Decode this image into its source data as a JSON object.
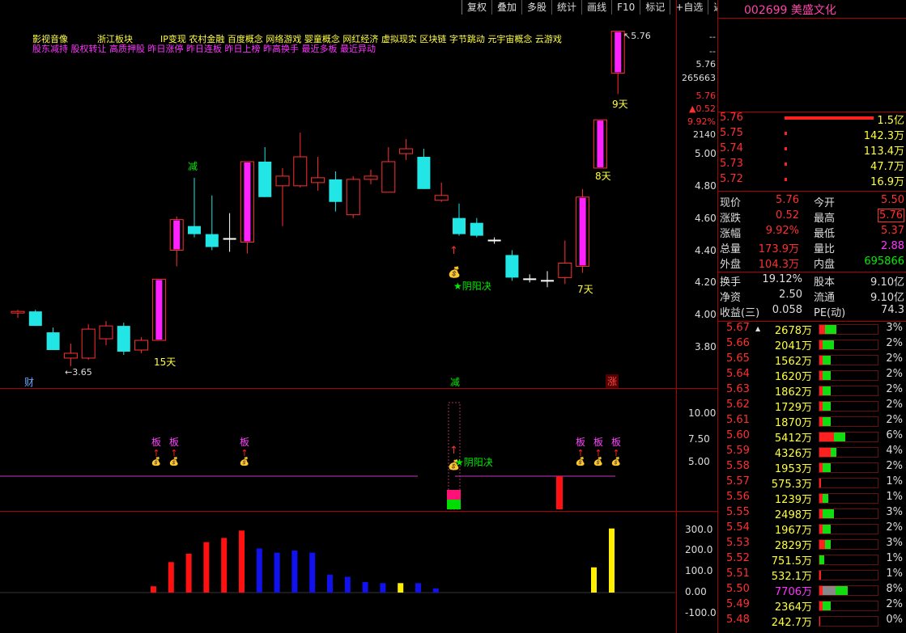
{
  "toolbar": [
    "复权",
    "叠加",
    "多股",
    "统计",
    "画线",
    "F10",
    "标记",
    "+自选",
    "返回"
  ],
  "stock": {
    "code": "002699",
    "name": "美盛文化"
  },
  "concepts": {
    "row1a": "影视音像",
    "row1b": "浙江板块",
    "row1c": "IP变现 农村金融 百度概念 网络游戏 婴童概念 网红经济 虚拟现实 区块链 字节跳动 元宇宙概念 云游戏",
    "row2": "股东减持 股权转让 高质押股 昨日涨停 昨日连板 昨日上榜 昨高换手 最近多板 最近异动"
  },
  "chart_labels": {
    "high_marker": "5.76",
    "low_marker": "3.65",
    "days": [
      "15天",
      "7天",
      "8天",
      "9天"
    ],
    "jian": "减",
    "yinyang": "★阴阳决",
    "bottom_cai": "财",
    "bottom_jian": "减",
    "bottom_zhang": "涨",
    "ban": "板"
  },
  "price_axis": {
    "top_values": [
      "--",
      "--",
      "5.76",
      "265663",
      "5.76",
      "▲0.52",
      "9.92%",
      "2140"
    ],
    "ticks": [
      "5.00",
      "4.80",
      "4.60",
      "4.40",
      "4.20",
      "4.00",
      "3.80"
    ]
  },
  "mid_axis": [
    "10.00",
    "7.50",
    "5.00"
  ],
  "bottom_axis": [
    "300.0",
    "200.0",
    "100.0",
    "0.00",
    "-100.0"
  ],
  "chart_data": {
    "type": "candlestick",
    "ylim": [
      3.6,
      5.85
    ],
    "candles": [
      {
        "o": 4.01,
        "h": 4.03,
        "l": 3.98,
        "c": 4.02,
        "t": "r"
      },
      {
        "o": 4.02,
        "h": 4.03,
        "l": 3.96,
        "c": 3.93,
        "t": "c"
      },
      {
        "o": 3.89,
        "h": 3.92,
        "l": 3.78,
        "c": 3.78,
        "t": "c"
      },
      {
        "o": 3.76,
        "h": 3.82,
        "l": 3.68,
        "c": 3.73,
        "t": "r"
      },
      {
        "o": 3.73,
        "h": 3.94,
        "l": 3.72,
        "c": 3.91,
        "t": "r"
      },
      {
        "o": 3.85,
        "h": 3.96,
        "l": 3.81,
        "c": 3.93,
        "t": "r"
      },
      {
        "o": 3.93,
        "h": 3.95,
        "l": 3.75,
        "c": 3.77,
        "t": "c"
      },
      {
        "o": 3.78,
        "h": 3.86,
        "l": 3.76,
        "c": 3.84,
        "t": "r"
      },
      {
        "o": 3.84,
        "h": 4.21,
        "l": 3.84,
        "c": 4.22,
        "t": "m"
      },
      {
        "o": 4.4,
        "h": 4.61,
        "l": 4.3,
        "c": 4.59,
        "t": "m"
      },
      {
        "o": 4.55,
        "h": 4.85,
        "l": 4.48,
        "c": 4.5,
        "t": "c"
      },
      {
        "o": 4.5,
        "h": 4.74,
        "l": 4.4,
        "c": 4.42,
        "t": "c"
      },
      {
        "o": 4.47,
        "h": 4.63,
        "l": 4.39,
        "c": 4.47,
        "t": "w"
      },
      {
        "o": 4.45,
        "h": 4.95,
        "l": 4.38,
        "c": 4.95,
        "t": "m"
      },
      {
        "o": 4.95,
        "h": 5.04,
        "l": 4.74,
        "c": 4.73,
        "t": "c"
      },
      {
        "o": 4.86,
        "h": 4.91,
        "l": 4.55,
        "c": 4.8,
        "t": "r"
      },
      {
        "o": 4.8,
        "h": 5.13,
        "l": 4.79,
        "c": 4.98,
        "t": "r"
      },
      {
        "o": 4.85,
        "h": 4.98,
        "l": 4.77,
        "c": 4.82,
        "t": "r"
      },
      {
        "o": 4.84,
        "h": 4.89,
        "l": 4.64,
        "c": 4.7,
        "t": "c"
      },
      {
        "o": 4.62,
        "h": 4.86,
        "l": 4.6,
        "c": 4.84,
        "t": "r"
      },
      {
        "o": 4.84,
        "h": 4.9,
        "l": 4.81,
        "c": 4.86,
        "t": "r"
      },
      {
        "o": 4.76,
        "h": 5.04,
        "l": 4.76,
        "c": 4.95,
        "t": "r"
      },
      {
        "o": 5.0,
        "h": 5.09,
        "l": 4.96,
        "c": 5.03,
        "t": "r"
      },
      {
        "o": 4.98,
        "h": 5.03,
        "l": 4.79,
        "c": 4.78,
        "t": "c"
      },
      {
        "o": 4.74,
        "h": 4.82,
        "l": 4.7,
        "c": 4.71,
        "t": "r"
      },
      {
        "o": 4.6,
        "h": 4.69,
        "l": 4.49,
        "c": 4.5,
        "t": "c"
      },
      {
        "o": 4.57,
        "h": 4.6,
        "l": 4.48,
        "c": 4.49,
        "t": "c"
      },
      {
        "o": 4.46,
        "h": 4.48,
        "l": 4.44,
        "c": 4.46,
        "t": "w"
      },
      {
        "o": 4.37,
        "h": 4.4,
        "l": 4.21,
        "c": 4.23,
        "t": "c"
      },
      {
        "o": 4.22,
        "h": 4.25,
        "l": 4.2,
        "c": 4.22,
        "t": "w"
      },
      {
        "o": 4.21,
        "h": 4.27,
        "l": 4.17,
        "c": 4.21,
        "t": "w"
      },
      {
        "o": 4.23,
        "h": 4.46,
        "l": 4.19,
        "c": 4.32,
        "t": "r"
      },
      {
        "o": 4.3,
        "h": 4.78,
        "l": 4.26,
        "c": 4.73,
        "t": "m"
      },
      {
        "o": 5.21,
        "h": 5.18,
        "l": 4.91,
        "c": 4.91,
        "t": "m"
      },
      {
        "o": 5.76,
        "h": 5.76,
        "l": 5.37,
        "c": 5.5,
        "t": "m"
      }
    ],
    "bottom_bars": [
      {
        "v": 30,
        "c": "r"
      },
      {
        "v": 145,
        "c": "r"
      },
      {
        "v": 185,
        "c": "r"
      },
      {
        "v": 240,
        "c": "r"
      },
      {
        "v": 260,
        "c": "r"
      },
      {
        "v": 295,
        "c": "r"
      },
      {
        "v": 210,
        "c": "b"
      },
      {
        "v": 190,
        "c": "b"
      },
      {
        "v": 200,
        "c": "b"
      },
      {
        "v": 190,
        "c": "b"
      },
      {
        "v": 85,
        "c": "b"
      },
      {
        "v": 75,
        "c": "b"
      },
      {
        "v": 50,
        "c": "b"
      },
      {
        "v": 45,
        "c": "b"
      },
      {
        "v": 45,
        "c": "y"
      },
      {
        "v": 45,
        "c": "b"
      },
      {
        "v": 20,
        "c": "b"
      },
      {
        "v": 0,
        "c": "n"
      },
      {
        "v": 0,
        "c": "n"
      },
      {
        "v": 0,
        "c": "n"
      },
      {
        "v": 0,
        "c": "n"
      },
      {
        "v": 0,
        "c": "n"
      },
      {
        "v": 0,
        "c": "n"
      },
      {
        "v": 0,
        "c": "n"
      },
      {
        "v": 0,
        "c": "n"
      },
      {
        "v": 0,
        "c": "n"
      },
      {
        "v": 0,
        "c": "n"
      },
      {
        "v": 0,
        "c": "n"
      },
      {
        "v": 0,
        "c": "n"
      },
      {
        "v": 0,
        "c": "n"
      },
      {
        "v": 0,
        "c": "n"
      },
      {
        "v": 0,
        "c": "n"
      },
      {
        "v": 120,
        "c": "y"
      },
      {
        "v": 305,
        "c": "y"
      }
    ]
  },
  "orderbook": [
    {
      "p": "5.76",
      "v": "1.5亿",
      "bar": 1.0
    },
    {
      "p": "5.75",
      "v": "142.3万",
      "bar": 0.02
    },
    {
      "p": "5.74",
      "v": "113.4万",
      "bar": 0.02
    },
    {
      "p": "5.73",
      "v": "47.7万",
      "bar": 0.01
    },
    {
      "p": "5.72",
      "v": "16.9万",
      "bar": 0.01
    }
  ],
  "quote": [
    {
      "l1": "现价",
      "v1": "5.76",
      "c1": "red",
      "l2": "今开",
      "v2": "5.50",
      "c2": "red"
    },
    {
      "l1": "涨跌",
      "v1": "0.52",
      "c1": "red",
      "l2": "最高",
      "v2": "5.76",
      "c2": "red"
    },
    {
      "l1": "涨幅",
      "v1": "9.92%",
      "c1": "red",
      "l2": "最低",
      "v2": "5.37",
      "c2": "red"
    },
    {
      "l1": "总量",
      "v1": "173.9万",
      "c1": "red",
      "l2": "量比",
      "v2": "2.88",
      "c2": "mag"
    },
    {
      "l1": "外盘",
      "v1": "104.3万",
      "c1": "red",
      "l2": "内盘",
      "v2": "695866",
      "c2": "grn"
    }
  ],
  "fundamentals": [
    {
      "l1": "换手",
      "v1": "19.12%",
      "l2": "股本",
      "v2": "9.10亿"
    },
    {
      "l1": "净资",
      "v1": "2.50",
      "l2": "流通",
      "v2": "9.10亿"
    },
    {
      "l1": "收益(三)",
      "v1": "0.058",
      "l2": "PE(动)",
      "v2": "74.3"
    }
  ],
  "distribution": [
    {
      "p": "5.67",
      "v": "2678万",
      "pct": "3%",
      "r": 0.1,
      "g": 0.2
    },
    {
      "p": "5.66",
      "v": "2041万",
      "pct": "2%",
      "r": 0.05,
      "g": 0.2
    },
    {
      "p": "5.65",
      "v": "1562万",
      "pct": "2%",
      "r": 0.05,
      "g": 0.15
    },
    {
      "p": "5.64",
      "v": "1620万",
      "pct": "2%",
      "r": 0.05,
      "g": 0.15
    },
    {
      "p": "5.63",
      "v": "1862万",
      "pct": "2%",
      "r": 0.05,
      "g": 0.15
    },
    {
      "p": "5.62",
      "v": "1729万",
      "pct": "2%",
      "r": 0.05,
      "g": 0.15
    },
    {
      "p": "5.61",
      "v": "1870万",
      "pct": "2%",
      "r": 0.05,
      "g": 0.15
    },
    {
      "p": "5.60",
      "v": "5412万",
      "pct": "6%",
      "r": 0.25,
      "g": 0.2
    },
    {
      "p": "5.59",
      "v": "4326万",
      "pct": "4%",
      "r": 0.2,
      "g": 0.1
    },
    {
      "p": "5.58",
      "v": "1953万",
      "pct": "2%",
      "r": 0.05,
      "g": 0.15
    },
    {
      "p": "5.57",
      "v": "575.3万",
      "pct": "1%",
      "r": 0.03,
      "g": 0.0
    },
    {
      "p": "5.56",
      "v": "1239万",
      "pct": "1%",
      "r": 0.05,
      "g": 0.1
    },
    {
      "p": "5.55",
      "v": "2498万",
      "pct": "3%",
      "r": 0.05,
      "g": 0.2
    },
    {
      "p": "5.54",
      "v": "1967万",
      "pct": "2%",
      "r": 0.05,
      "g": 0.15
    },
    {
      "p": "5.53",
      "v": "2829万",
      "pct": "3%",
      "r": 0.1,
      "g": 0.1
    },
    {
      "p": "5.52",
      "v": "751.5万",
      "pct": "1%",
      "r": 0.0,
      "g": 0.08
    },
    {
      "p": "5.51",
      "v": "532.1万",
      "pct": "1%",
      "r": 0.03,
      "g": 0.0
    },
    {
      "p": "5.50",
      "v": "7706万",
      "pct": "8%",
      "r": 0.05,
      "g": 0.45,
      "gray": true
    },
    {
      "p": "5.49",
      "v": "2364万",
      "pct": "2%",
      "r": 0.05,
      "g": 0.15
    },
    {
      "p": "5.48",
      "v": "242.7万",
      "pct": "0%",
      "r": 0.02,
      "g": 0.0
    }
  ]
}
